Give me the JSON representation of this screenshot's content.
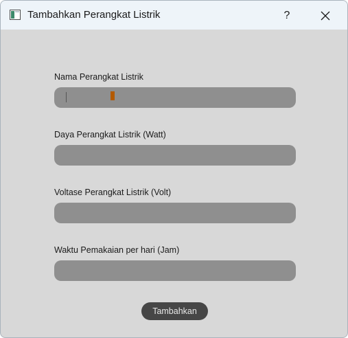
{
  "window": {
    "title": "Tambahkan Perangkat Listrik",
    "help_label": "?"
  },
  "form": {
    "fields": [
      {
        "label": "Nama Perangkat Listrik",
        "value": ""
      },
      {
        "label": "Daya Perangkat Listrik (Watt)",
        "value": ""
      },
      {
        "label": "Voltase Perangkat Listrik (Volt)",
        "value": ""
      },
      {
        "label": "Waktu Pemakaian per hari (Jam)",
        "value": ""
      }
    ],
    "submit_label": "Tambahkan"
  },
  "icons": {
    "app": "window-app-icon",
    "close": "close-icon"
  },
  "colors": {
    "window_bg": "#d8d8d8",
    "titlebar_bg": "#eef4f9",
    "input_bg": "#8f8f8f",
    "button_bg": "#464646",
    "cursor": "#b35a00"
  }
}
